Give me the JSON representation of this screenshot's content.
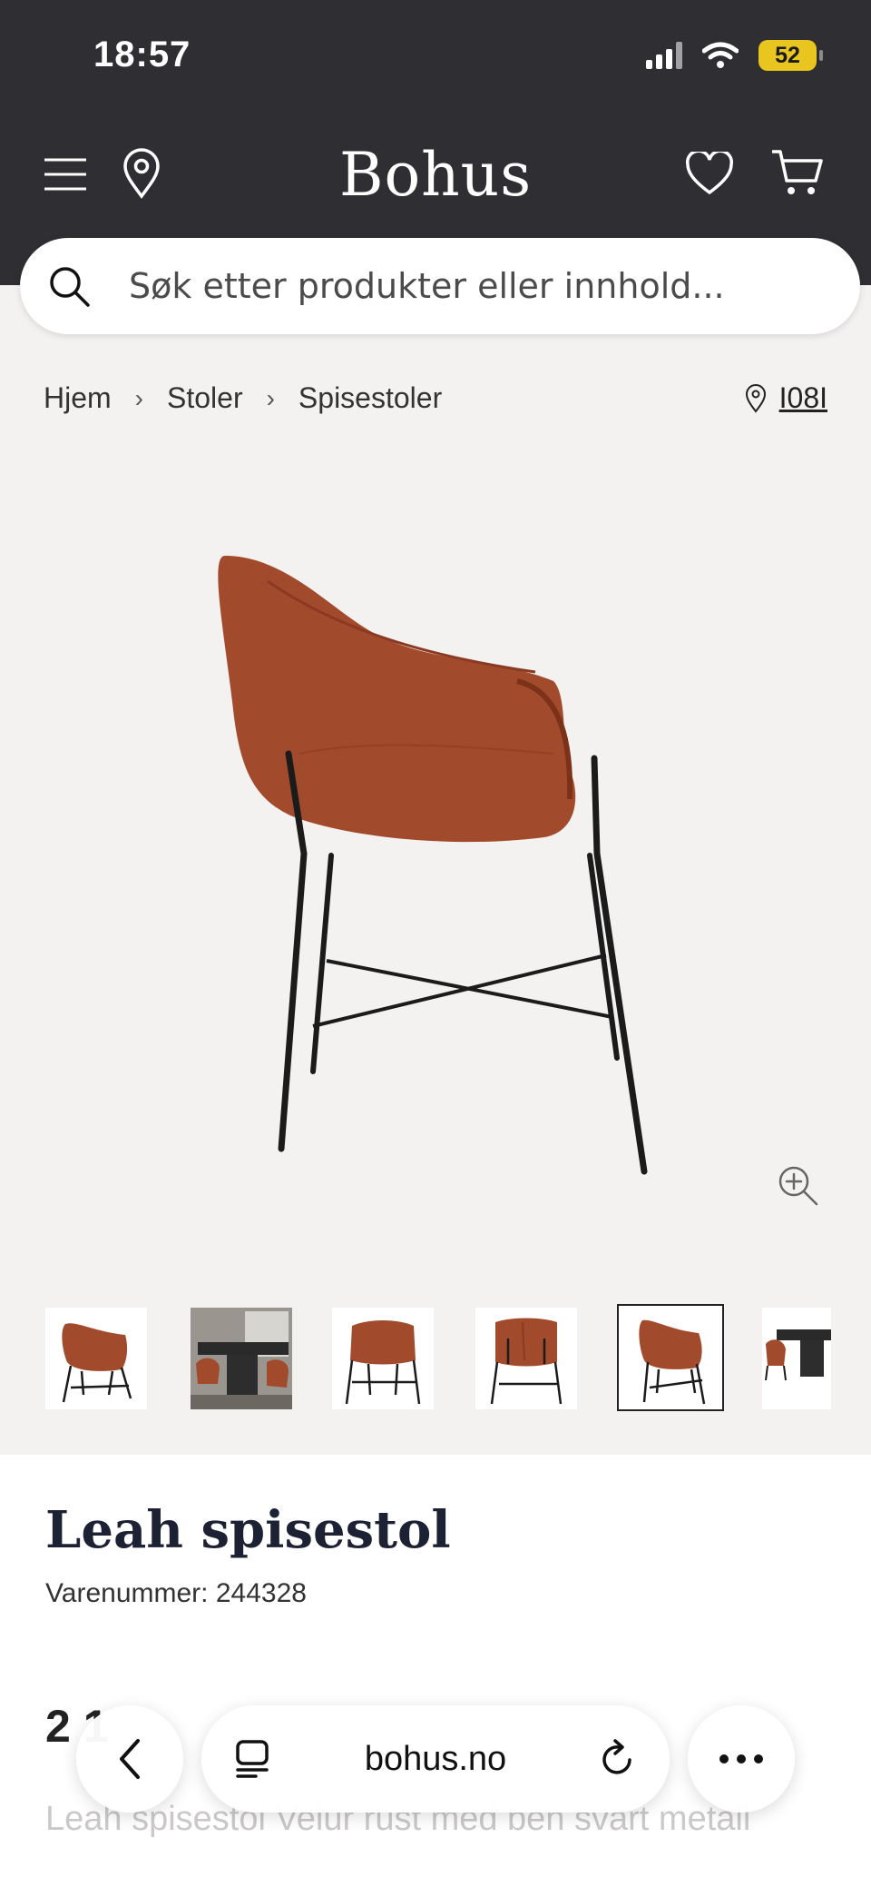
{
  "status_bar": {
    "time": "18:57",
    "battery": "52"
  },
  "header": {
    "logo": "Bohus"
  },
  "search": {
    "placeholder": "Søk etter produkter eller innhold..."
  },
  "breadcrumb": {
    "items": [
      "Hjem",
      "Stoler",
      "Spisestoler"
    ]
  },
  "store": {
    "label": "I08I"
  },
  "gallery": {
    "thumbnail_count": 6,
    "active_index": 4
  },
  "product": {
    "title": "Leah spisestol",
    "sku": "Varenummer: 244328",
    "price": "2 1",
    "description": "Leah spisestol Velur rust med ben svart metall"
  },
  "browser": {
    "url": "bohus.no"
  },
  "colors": {
    "header_bg": "#2f2e33",
    "page_bg": "#f4f2f0",
    "chair": "#a24a2c",
    "title": "#1c2133"
  }
}
